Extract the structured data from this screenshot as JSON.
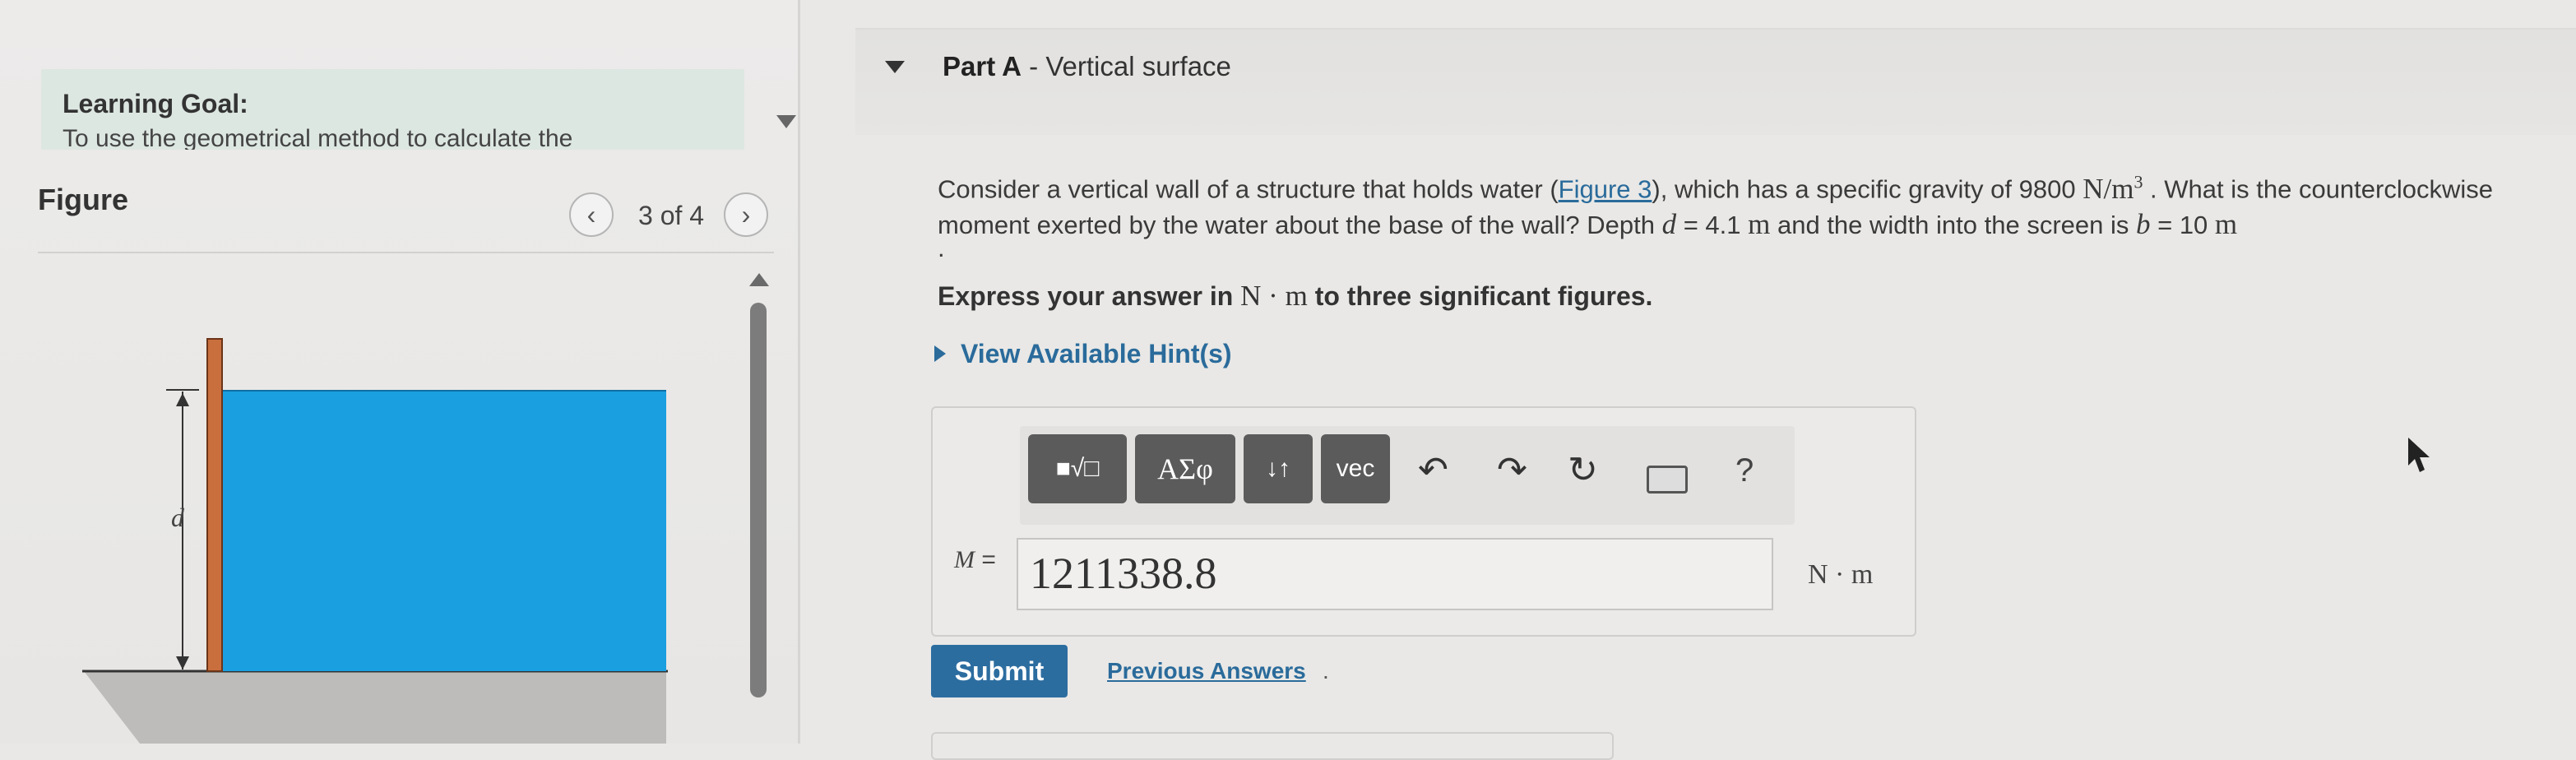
{
  "learning_goal": {
    "title": "Learning Goal:",
    "text": "To use the geometrical method to calculate the"
  },
  "figure": {
    "header": "Figure",
    "counter": "3 of 4",
    "prev_icon": "chevron-left-icon",
    "next_icon": "chevron-right-icon",
    "diagram": {
      "depth_label": "d",
      "wall_color": "#c96f3e",
      "water_color": "#1a9fe0",
      "ground_color": "#b9b9b9"
    }
  },
  "part": {
    "label": "Part A",
    "separator": " - ",
    "title": "Vertical surface"
  },
  "question": {
    "text_1": "Consider a vertical wall of a structure that holds water (",
    "figure_link": "Figure 3",
    "text_2": "), which has a specific gravity of 9800 ",
    "sg_unit_base": "N/m",
    "sg_unit_exp": "3",
    "text_3": " . What is the counterclockwise moment exerted by the water about the base of the wall? Depth ",
    "depth_var": "d",
    "depth_value": " = 4.1 ",
    "depth_unit": "m",
    "text_4": " and the width into the screen is ",
    "width_var": "b",
    "width_value": " = 10 ",
    "width_unit": "m",
    "trailing": "."
  },
  "instruction": {
    "text_1": "Express your answer in ",
    "unit": "N · m",
    "text_2": " to three significant figures."
  },
  "hints_label": "View Available Hint(s)",
  "toolbar": {
    "templates_label": "■√□",
    "symbols_label": "ΑΣφ",
    "arrows_label": "↓↑",
    "vector_label": "vec",
    "undo_icon": "undo-icon",
    "redo_icon": "redo-icon",
    "reset_icon": "reset-icon",
    "keyboard_icon": "keyboard-icon",
    "help_label": "?"
  },
  "answer": {
    "label_var": "M",
    "label_eq": " =",
    "value": "1211338.8",
    "unit": "N · m"
  },
  "buttons": {
    "submit": "Submit",
    "previous_answers": "Previous Answers",
    "previous_answers_suffix": "."
  },
  "colors": {
    "accent": "#2c6da0",
    "link": "#2a6b9b",
    "learning_goal_bg": "#dde7e2"
  }
}
